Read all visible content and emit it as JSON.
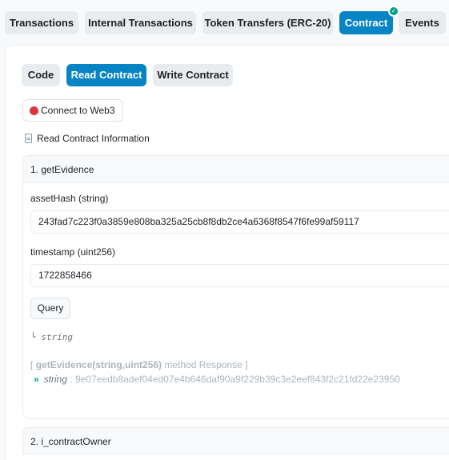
{
  "top_tabs": [
    {
      "label": "Transactions",
      "active": false
    },
    {
      "label": "Internal Transactions",
      "active": false
    },
    {
      "label": "Token Transfers (ERC-20)",
      "active": false
    },
    {
      "label": "Contract",
      "active": true
    },
    {
      "label": "Events",
      "active": false
    }
  ],
  "sub_tabs": [
    {
      "label": "Code",
      "active": false
    },
    {
      "label": "Read Contract",
      "active": true
    },
    {
      "label": "Write Contract",
      "active": false
    }
  ],
  "connect": {
    "label": "Connect to Web3",
    "status_color": "#dc3545"
  },
  "info": {
    "label": "Read Contract Information"
  },
  "functions": [
    {
      "header": "1. getEvidence",
      "params": [
        {
          "label": "assetHash (string)",
          "value": "243fad7c223f0a3859e808ba325a25cb8f8db2ce4a6368f8547f6fe99af59117"
        },
        {
          "label": "timestamp (uint256)",
          "value": "1722858466"
        }
      ],
      "query_label": "Query",
      "output_type": "string",
      "response": {
        "bracket_open": "[",
        "method": "getEvidence(string,uint256)",
        "suffix": "method Response ]",
        "type": "string",
        "separator": ":",
        "value": "9e07eedb8adef04ed07e4b646daf90a9f229b39c3e2eef843f2c21fd22e23950"
      }
    },
    {
      "header": "2. i_contractOwner"
    }
  ],
  "colors": {
    "accent": "#0784c3",
    "success": "#00a186"
  }
}
